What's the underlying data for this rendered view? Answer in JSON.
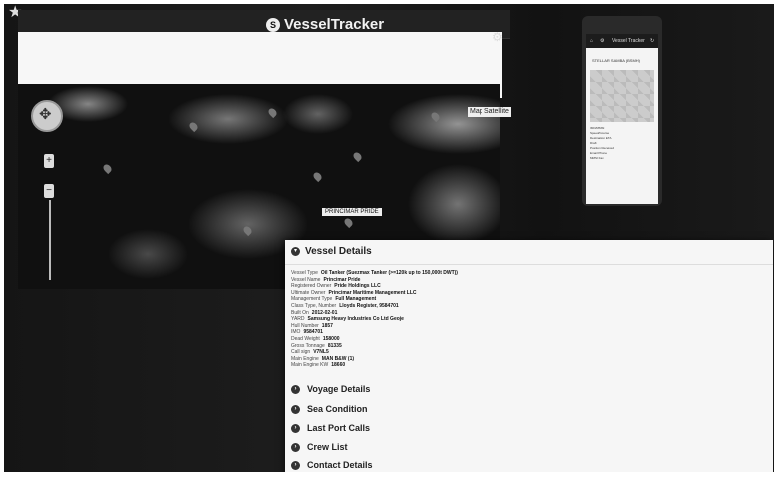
{
  "app": {
    "title": "VesselTracker",
    "badge": "S"
  },
  "map": {
    "type_buttons": [
      "Map",
      "Satellite"
    ],
    "zoom_in": "+",
    "zoom_out": "−",
    "marker_label": "PRINCIMAR PRIDE"
  },
  "phone": {
    "app_title": "Vessel Tracker",
    "vessel_name": "STELLAR SAMBA (BSMH)",
    "rows": [
      {
        "k": "IMO/MMSI",
        "v": ""
      },
      {
        "k": "Speed/Course",
        "v": ""
      },
      {
        "k": "Destination ETA",
        "v": ""
      },
      {
        "k": "Draft",
        "v": ""
      },
      {
        "k": "Position Received",
        "v": ""
      },
      {
        "k": "Email Phone",
        "v": ""
      },
      {
        "k": "MMSI Fax",
        "v": ""
      }
    ]
  },
  "vessel_details": {
    "title": "Vessel Details",
    "fields": [
      {
        "k": "Vessel Type",
        "v": "Oil Tanker (Suezmax Tanker (>=120k up to 150,000t DWT))"
      },
      {
        "k": "Vessel Name",
        "v": "Princimar Pride"
      },
      {
        "k": "Registered Owner",
        "v": "Pride Holdings LLC"
      },
      {
        "k": "Ultimate Owner",
        "v": "Princimar Maritime Management LLC"
      },
      {
        "k": "Management Type",
        "v": "Full Management"
      },
      {
        "k": "Class Type, Number",
        "v": "Lloyds Register, 9584701"
      },
      {
        "k": "Built On",
        "v": "2012-02-01"
      },
      {
        "k": "YARD",
        "v": "Samsung Heavy Industries Co Ltd  Geoje"
      },
      {
        "k": "Hull Number",
        "v": "1857"
      },
      {
        "k": "IMO",
        "v": "9584701"
      },
      {
        "k": "Dead Weight",
        "v": "158000"
      },
      {
        "k": "Gross Tonnage",
        "v": "81335"
      },
      {
        "k": "Call sign",
        "v": "V7NL5"
      },
      {
        "k": "Main Engine",
        "v": "MAN B&W (1)"
      },
      {
        "k": "Main Engine KW",
        "v": "18660"
      }
    ],
    "sections": [
      "Voyage Details",
      "Sea Condition",
      "Last Port Calls",
      "Crew List",
      "Contact Details"
    ]
  }
}
